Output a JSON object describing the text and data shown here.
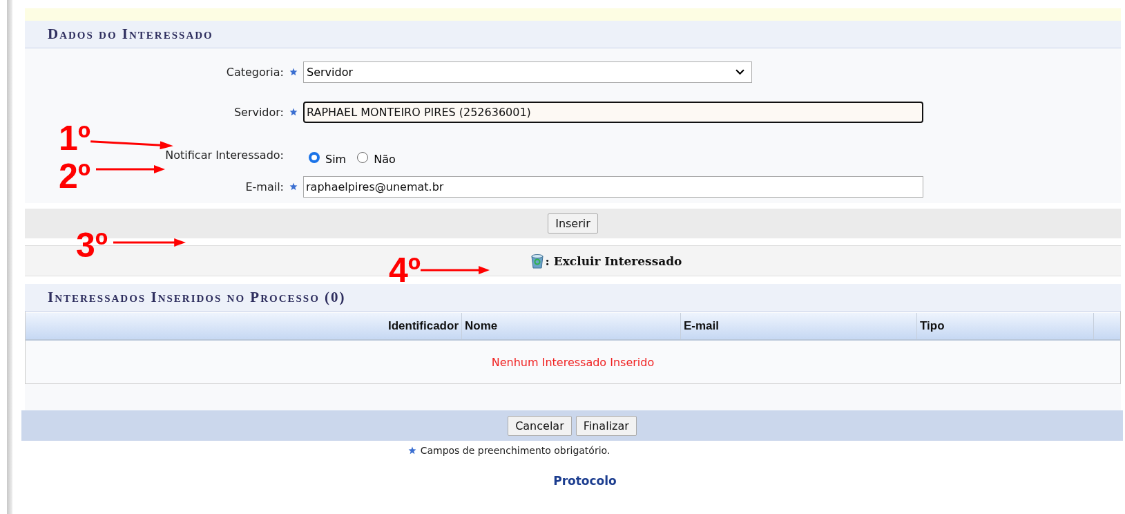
{
  "form_section": {
    "title": "Dados do Interessado",
    "fields": [
      {
        "kind": "select",
        "label": "Categoria:",
        "required": true,
        "value": "Servidor"
      },
      {
        "kind": "text",
        "label": "Servidor:",
        "required": true,
        "value": "RAPHAEL MONTEIRO PIRES (252636001)",
        "focused": true
      },
      {
        "kind": "radio",
        "label": "Notificar Interessado:",
        "required": false,
        "options": [
          {
            "label": "Sim",
            "selected": true
          },
          {
            "label": "Não",
            "selected": false
          }
        ]
      },
      {
        "kind": "text",
        "label": "E-mail:",
        "required": true,
        "value": "raphaelpires@unemat.br",
        "focused": false
      }
    ],
    "insert_button": "Inserir"
  },
  "legend": {
    "text": ": Excluir Interessado"
  },
  "table_section": {
    "title": "Interessados Inseridos no Processo (0)",
    "columns": [
      "Identificador",
      "Nome",
      "E-mail",
      "Tipo"
    ],
    "empty_message": "Nenhum Interessado Inserido"
  },
  "footer_buttons": [
    "Cancelar",
    "Finalizar"
  ],
  "required_note": "Campos de preenchimento obrigatório.",
  "footer_link": "Protocolo",
  "annotations": [
    {
      "label": "1º"
    },
    {
      "label": "2º"
    },
    {
      "label": "3º"
    },
    {
      "label": "4º"
    }
  ]
}
